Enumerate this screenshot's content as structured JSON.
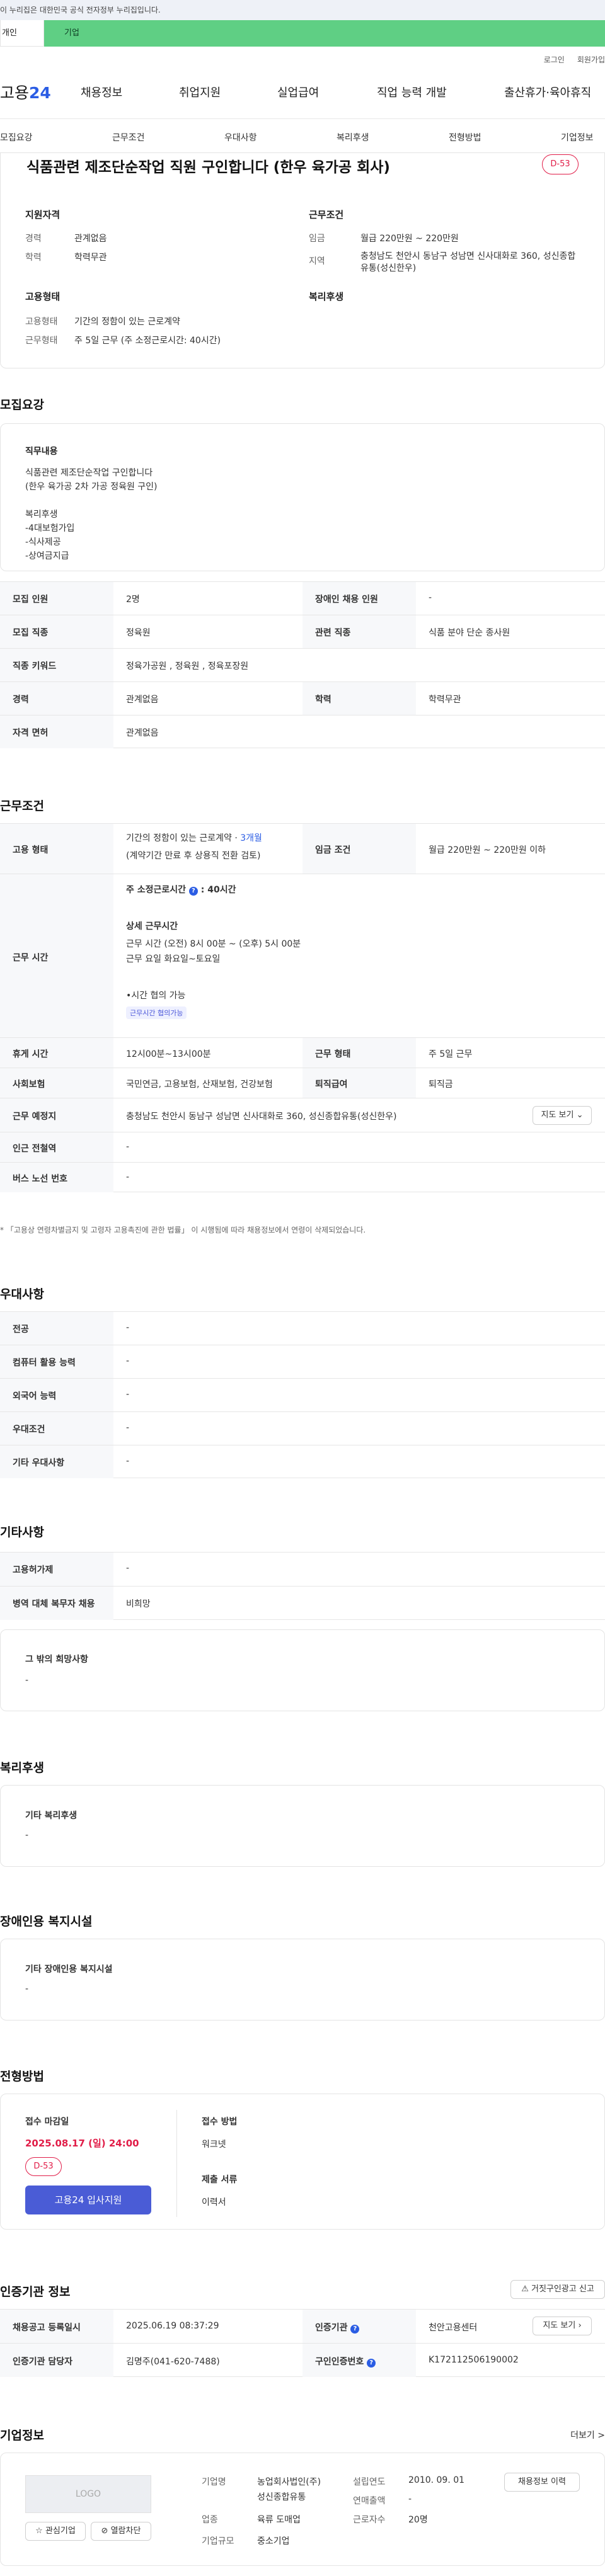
{
  "gov_banner": "이 누리집은 대한민국 공식 전자정부 누리집입니다.",
  "user_tabs": {
    "individual": "개인",
    "business": "기업"
  },
  "util": {
    "login": "로그인",
    "join": "회원가입"
  },
  "logo": {
    "brand": "고용",
    "num": "24"
  },
  "gnb": [
    "채용정보",
    "취업지원",
    "실업급여",
    "직업 능력 개발",
    "출산휴가·육아휴직"
  ],
  "subnav": [
    "모집요강",
    "근무조건",
    "우대사항",
    "복리후생",
    "전형방법",
    "기업정보"
  ],
  "job": {
    "title": "식품관련 제조단순작업 직원 구인합니다 (한우 육가공 회사)",
    "dday": "D-53"
  },
  "summary": {
    "qual_title": "지원자격",
    "career_l": "경력",
    "career_v": "관계없음",
    "edu_l": "학력",
    "edu_v": "학력무관",
    "cond_title": "근무조건",
    "wage_l": "임금",
    "wage_v": "월급 220만원 ~ 220만원",
    "area_l": "지역",
    "area_v": "충청남도 천안시 동남구 성남면 신사대화로 360, 성신종합유통(성신한우)",
    "emp_title": "고용형태",
    "type_l": "고용형태",
    "type_v": "기간의 정함이 있는 근로계약",
    "form_l": "근무형태",
    "form_v": "주 5일 근무 (주 소정근로시간: 40시간)",
    "welfare_title": "복리후생"
  },
  "recruit": {
    "title": "모집요강",
    "duty_title": "직무내용",
    "duty": [
      "식품관련 제조단순작업 구인합니다",
      "(한우 육가공 2차 가공 정육원 구인)",
      "",
      "복리후생",
      "-4대보험가입",
      "-식사제공",
      "-상여금지급"
    ],
    "rows": [
      [
        "모집 인원",
        "2명",
        "장애인 채용 인원",
        "-"
      ],
      [
        "모집 직종",
        "정육원",
        "관련 직종",
        "식품 분야 단순 종사원"
      ],
      [
        "직종 키워드",
        "정육가공원 , 정육원 , 정육포장원",
        "",
        ""
      ],
      [
        "경력",
        "관계없음",
        "학력",
        "학력무관"
      ],
      [
        "자격 면허",
        "관계없음",
        "",
        ""
      ]
    ]
  },
  "cond": {
    "title": "근무조건",
    "type_l": "고용 형태",
    "type_v1": "기간의 정함이 있는 근로계약 · ",
    "type_months": "3개월",
    "type_v2": "(계약기간 만료 후 상용직 전환 검토)",
    "wage_l": "임금 조건",
    "wage_v": "월급 220만원 ~ 220만원 이하",
    "time_l": "근무 시간",
    "week_label": "주 소정근로시간",
    "week_val": ": 40시간",
    "detail_title": "상세 근무시간",
    "detail1": "근무 시간 (오전) 8시 00분 ~ (오후) 5시 00분",
    "detail2": "근무 요일 화요일~토요일",
    "note": "•시간 협의 가능",
    "tag": "근무시간 협의가능",
    "rest_l": "휴게 시간",
    "rest_v": "12시00분~13시00분",
    "form_l": "근무 형태",
    "form_v": "주 5일 근무",
    "ins_l": "사회보험",
    "ins_v": "국민연금, 고용보험, 산재보험, 건강보험",
    "sev_l": "퇴직급여",
    "sev_v": "퇴직금",
    "place_l": "근무 예정지",
    "place_v": "충청남도 천안시 동남구 성남면 신사대화로 360, 성신종합유통(성신한우)",
    "map_btn": "지도 보기",
    "subway_l": "인근 전철역",
    "subway_v": "-",
    "bus_l": "버스 노선 번호",
    "bus_v": "-",
    "footnote": "* 「고용상 연령차별금지 및 고령자 고용촉진에 관한 법률」 이 시행됨에 따라 채용정보에서 연령이 삭제되었습니다."
  },
  "pref": {
    "title": "우대사항",
    "rows": [
      [
        "전공",
        "-"
      ],
      [
        "컴퓨터 활용 능력",
        "-"
      ],
      [
        "외국어 능력",
        "-"
      ],
      [
        "우대조건",
        "-"
      ],
      [
        "기타 우대사항",
        "-"
      ]
    ]
  },
  "etc": {
    "title": "기타사항",
    "rows": [
      [
        "고용허가제",
        "-"
      ],
      [
        "병역 대체 복무자 채용",
        "비희망"
      ]
    ],
    "box_title": "그 밖의 희망사항",
    "box_val": "-"
  },
  "welfare": {
    "title": "복리후생",
    "box_title": "기타 복리후생",
    "box_val": "-"
  },
  "disab": {
    "title": "장애인용 복지시설",
    "box_title": "기타 장애인용 복지시설",
    "box_val": "-"
  },
  "apply": {
    "title": "전형방법",
    "deadline_l": "접수 마감일",
    "deadline": "2025.08.17 (일) 24:00",
    "dday": "D-53",
    "btn": "고용24 입사지원",
    "method_l": "접수 방법",
    "method_v": "워크넷",
    "docs_l": "제출 서류",
    "docs_v": "이력서"
  },
  "cert": {
    "title": "인증기관 정보",
    "report_btn": "거짓구인광고 신고",
    "reg_l": "채용공고 등록일시",
    "reg_v": "2025.06.19 08:37:29",
    "org_l": "인증기관",
    "org_v": "천안고용센터",
    "map_btn": "지도 보기",
    "mgr_l": "인증기관 담당자",
    "mgr_v": "김명주(041-620-7488)",
    "no_l": "구인인증번호",
    "no_v": "K172112506190002"
  },
  "company": {
    "title": "기업정보",
    "more": "더보기 >",
    "logo": "LOGO",
    "fav": "관심기업",
    "block": "열람차단",
    "name_l": "기업명",
    "name_v1": "농업회사법인(주)",
    "name_v2": "성신종합유통",
    "ind_l": "업종",
    "ind_v": "육류 도매업",
    "size_l": "기업규모",
    "size_v": "중소기업",
    "est_l": "설립연도",
    "est_v": "2010. 09. 01",
    "sales_l": "연매출액",
    "sales_v": "-",
    "emp_l": "근로자수",
    "emp_v": "20명",
    "jobs_btn": "채용정보 이력"
  }
}
